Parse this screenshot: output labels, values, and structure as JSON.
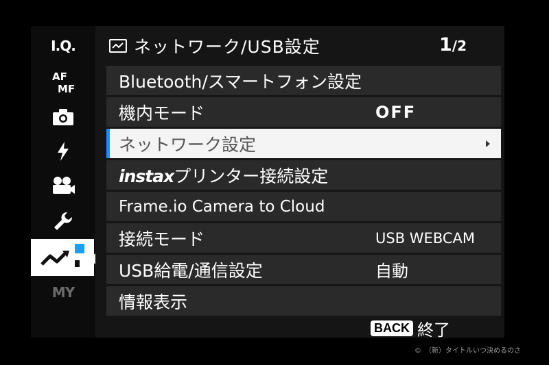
{
  "sidebar": {
    "items": [
      {
        "id": "iq",
        "label": "I.Q."
      },
      {
        "id": "af",
        "label": "AF/MF"
      },
      {
        "id": "shooting",
        "icon": "camera-icon"
      },
      {
        "id": "flash",
        "icon": "flash-icon"
      },
      {
        "id": "movie",
        "icon": "movie-camera-icon"
      },
      {
        "id": "setup",
        "icon": "wrench-icon"
      },
      {
        "id": "network",
        "icon": "network-icon",
        "selected": true
      },
      {
        "id": "my",
        "label": "MY"
      }
    ]
  },
  "header": {
    "title": "ネットワーク/USB設定",
    "page_current": "1",
    "page_total": "/2"
  },
  "menu": {
    "items": [
      {
        "label": "Bluetooth/スマートフォン設定",
        "value": ""
      },
      {
        "label": "機内モード",
        "value": "OFF"
      },
      {
        "label": "ネットワーク設定",
        "value": "",
        "selected": true
      },
      {
        "label_prefix": "instax",
        "label": "プリンター接続設定",
        "value": ""
      },
      {
        "label": "Frame.io Camera to Cloud",
        "value": ""
      },
      {
        "label": "接続モード",
        "value": "USB WEBCAM"
      },
      {
        "label": "USB給電/通信設定",
        "value": "自動"
      },
      {
        "label": "情報表示",
        "value": ""
      }
    ]
  },
  "footer": {
    "back_badge": "BACK",
    "back_label": "終了"
  },
  "watermark": "©　（新）タイトルいつ決めるのさ",
  "colors": {
    "accent": "#1a8cff",
    "row_bg": "#2a2a2a",
    "selected_bg": "#f4f4f4"
  }
}
